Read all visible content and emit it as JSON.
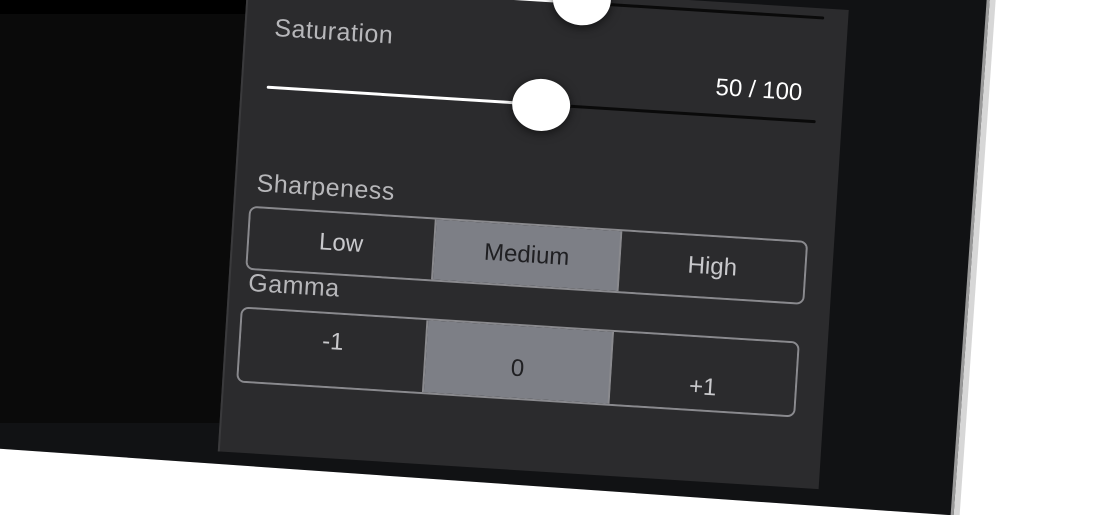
{
  "saturation": {
    "label": "Saturation",
    "value_text": "50 / 100",
    "value": 50,
    "max": 100
  },
  "previous_slider": {
    "level": 0.56
  },
  "sharpeness": {
    "label": "Sharpeness",
    "options": [
      "Low",
      "Medium",
      "High"
    ],
    "selected": "Medium"
  },
  "gamma": {
    "label": "Gamma",
    "options": [
      "-1",
      "0",
      "+1"
    ],
    "selected": "0"
  },
  "colors": {
    "panel": "#2b2b2d",
    "selected_segment": "#7d7f86",
    "slider_fill": "#ffffff",
    "label_text": "#b7b7ba"
  }
}
